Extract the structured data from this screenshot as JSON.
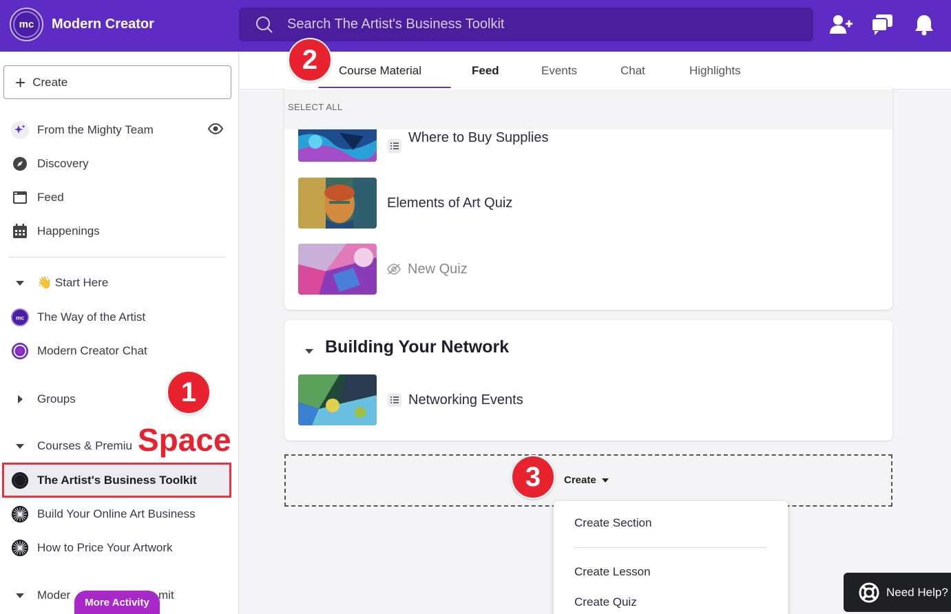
{
  "header": {
    "brand_logo_text": "mc",
    "brand_name": "Modern Creator",
    "search_placeholder": "Search The Artist's Business Toolkit"
  },
  "sidebar": {
    "create_label": "Create",
    "items": [
      {
        "label": "From the Mighty Team",
        "icon": "sparkle-icon"
      },
      {
        "label": "Discovery",
        "icon": "compass-icon"
      },
      {
        "label": "Feed",
        "icon": "feed-icon"
      },
      {
        "label": "Happenings",
        "icon": "calendar-icon"
      }
    ],
    "start_here": "👋 Start Here",
    "way_of_artist": "The Way of the Artist",
    "chat": "Modern Creator Chat",
    "groups": "Groups",
    "courses": "Courses & Premiu",
    "active_space": "The Artist's Business Toolkit",
    "build_business": "Build Your Online Art Business",
    "price_artwork": "How to Price Your Artwork",
    "modern_partial": "Moder",
    "modern_partial_end": "mit",
    "more_activity": "More Activity"
  },
  "annotations": {
    "badge1": "1",
    "badge2": "2",
    "badge3": "3",
    "space_label": "Space"
  },
  "tabs": [
    "Course Material",
    "Feed",
    "Events",
    "Chat",
    "Highlights"
  ],
  "main": {
    "select_all": "SELECT ALL",
    "lessons_top": [
      {
        "title": "Where to Buy Supplies"
      },
      {
        "title": "Elements of Art Quiz"
      },
      {
        "title": "New Quiz"
      }
    ],
    "section_title": "Building Your Network",
    "section_lessons": [
      {
        "title": "Networking Events"
      }
    ],
    "create_dropdown": "Create",
    "menu": [
      "Create Section",
      "Create Lesson",
      "Create Quiz"
    ]
  },
  "help": "Need Help?",
  "colors": {
    "brand_purple": "#5e2bc4",
    "accent_red": "#e8232f",
    "more_activity": "#a828c8"
  }
}
